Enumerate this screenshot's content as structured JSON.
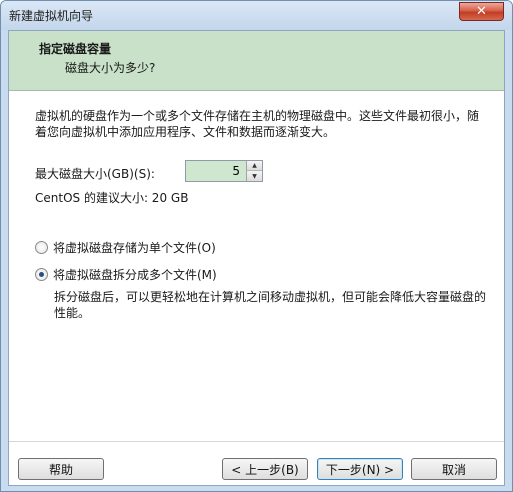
{
  "window": {
    "title": "新建虚拟机向导",
    "close_glyph": "✕"
  },
  "header": {
    "title": "指定磁盘容量",
    "subtitle": "磁盘大小为多少?"
  },
  "description": "虚拟机的硬盘作为一个或多个文件存储在主机的物理磁盘中。这些文件最初很小，随着您向虚拟机中添加应用程序、文件和数据而逐渐变大。",
  "disk_size": {
    "label": "最大磁盘大小(GB)(S):",
    "value": "5"
  },
  "recommended": "CentOS 的建议大小: 20 GB",
  "options": [
    {
      "label": "将虚拟磁盘存储为单个文件(O)",
      "checked": false
    },
    {
      "label": "将虚拟磁盘拆分成多个文件(M)",
      "checked": true
    }
  ],
  "split_hint": "拆分磁盘后，可以更轻松地在计算机之间移动虚拟机，但可能会降低大容量磁盘的性能。",
  "buttons": {
    "help": "帮助",
    "back": "< 上一步(B)",
    "next": "下一步(N) >",
    "cancel": "取消"
  }
}
